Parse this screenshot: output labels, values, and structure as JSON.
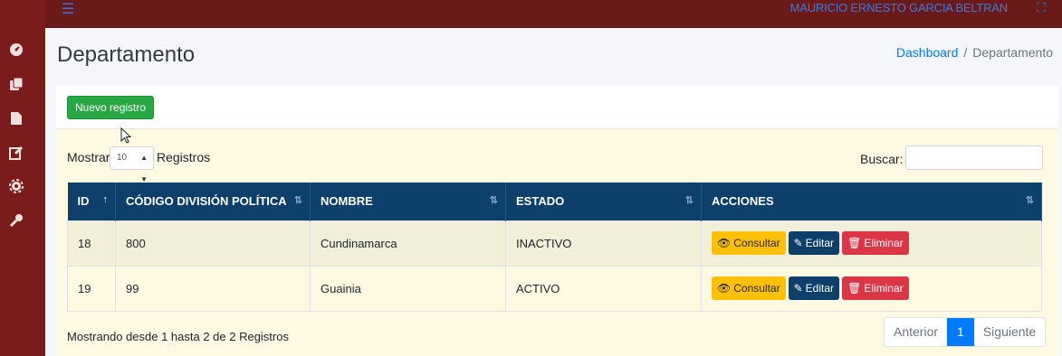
{
  "topbar": {
    "menu_icon": "hamburger-icon",
    "username": "MAURICIO ERNESTO GARCIA BELTRAN",
    "expand_icon": "expand-icon"
  },
  "sidebar": {
    "icons": [
      "dashboard-icon",
      "copy-icon",
      "file-icon",
      "edit-icon",
      "gear-icon",
      "key-icon"
    ]
  },
  "header": {
    "title": "Departamento",
    "breadcrumb": {
      "link": "Dashboard",
      "separator": "/",
      "current": "Departamento"
    }
  },
  "toolbar": {
    "new_label": "Nuevo registro"
  },
  "list": {
    "show_label": "Mostrar",
    "page_size": "10",
    "records_label": "Registros",
    "search_label": "Buscar:",
    "search_value": "",
    "columns": [
      "ID",
      "CÓDIGO DIVISIÓN POLÍTICA",
      "NOMBRE",
      "ESTADO",
      "ACCIONES"
    ],
    "rows": [
      {
        "id": "18",
        "code": "800",
        "name": "Cundinamarca",
        "status": "INACTIVO"
      },
      {
        "id": "19",
        "code": "99",
        "name": "Guainia",
        "status": "ACTIVO"
      }
    ],
    "actions": {
      "view": "Consultar",
      "edit": "Editar",
      "delete": "Eliminar"
    },
    "info": "Mostrando desde 1 hasta 2 de 2 Registros",
    "pagination": {
      "prev": "Anterior",
      "current": "1",
      "next": "Siguiente"
    }
  },
  "colors": {
    "sidebar": "#7a1c1c",
    "header_row": "#0d3f6b",
    "primary": "#007bff",
    "success": "#28a745",
    "warning": "#ffc107",
    "danger": "#dc3545"
  }
}
